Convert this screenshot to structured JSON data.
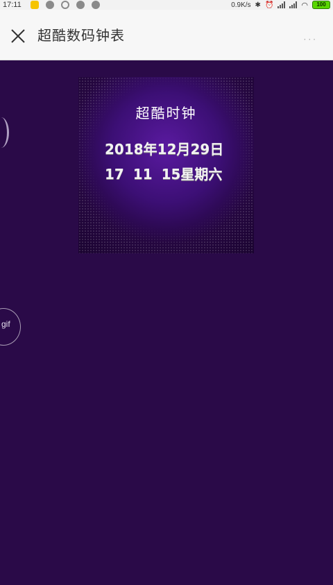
{
  "status_bar": {
    "time": "17:11",
    "net_speed": "0.9K/s",
    "battery": "100",
    "icons": [
      "app-icon",
      "circle-icon",
      "search-icon",
      "blocked-icon",
      "circle-icon",
      "bluetooth-icon",
      "alarm-icon",
      "signal-icon",
      "signal-icon",
      "wifi-icon",
      "battery-icon"
    ]
  },
  "header": {
    "title": "超酷数码钟表",
    "more": "···"
  },
  "clock": {
    "title": "超酷时钟",
    "date": "2018年12月29日",
    "time": "17  11  15星期六"
  },
  "badge": {
    "gif": "gif"
  },
  "colors": {
    "content_bg": "#2a0a48",
    "card_center": "#5a1aa0",
    "header_bg": "#f7f7f7"
  }
}
